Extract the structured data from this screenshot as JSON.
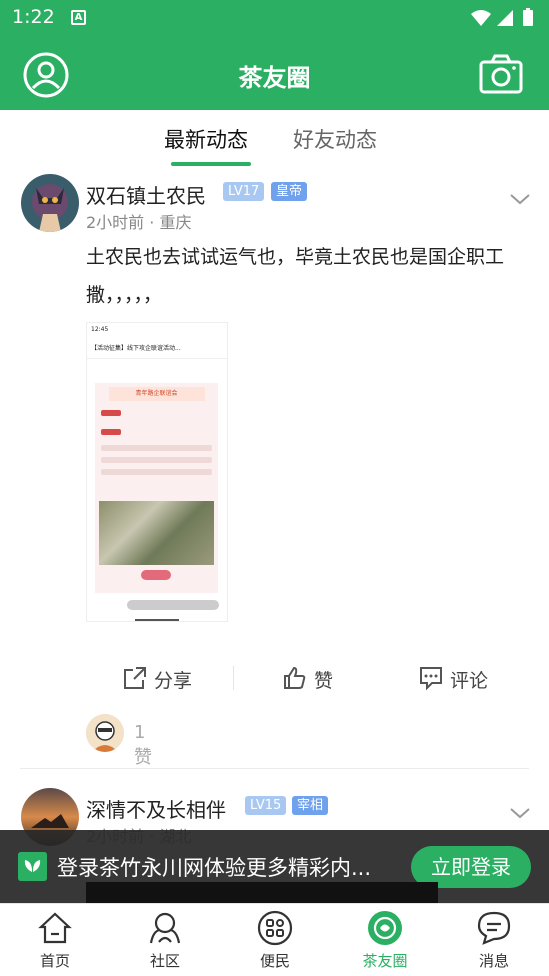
{
  "status_bar": {
    "time": "1:22",
    "notification_icon": "A"
  },
  "header": {
    "title": "茶友圈"
  },
  "tabs": [
    {
      "label": "最新动态",
      "active": true
    },
    {
      "label": "好友动态",
      "active": false
    }
  ],
  "posts": [
    {
      "author": "双石镇土农民",
      "level": "LV17",
      "rank": "皇帝",
      "meta": "2小时前 · 重庆",
      "text": "土农民也去试试运气也，毕竟土农民也是国企职工撒，，，，，",
      "image": {
        "time": "12:45",
        "title": "【活动征集】线下攻企联谊活动...",
        "card_title": "青年路企联谊会"
      },
      "actions": {
        "share": "分享",
        "like": "赞",
        "comment": "评论"
      },
      "likes_count": "1赞"
    },
    {
      "author": "深情不及长相伴",
      "level": "LV15",
      "rank": "宰相",
      "meta": "2小时前 · 湖北"
    }
  ],
  "login_banner": {
    "text": "登录茶竹永川网体验更多精彩内...",
    "button": "立即登录"
  },
  "bottom_nav": [
    {
      "label": "首页",
      "icon": "home-icon",
      "active": false
    },
    {
      "label": "社区",
      "icon": "community-icon",
      "active": false
    },
    {
      "label": "便民",
      "icon": "services-icon",
      "active": false
    },
    {
      "label": "茶友圈",
      "icon": "tea-circle-icon",
      "active": true
    },
    {
      "label": "消息",
      "icon": "message-icon",
      "active": false
    }
  ],
  "colors": {
    "brand": "#2bb063",
    "level_badge": "#a8c8f2",
    "rank_badge": "#6fa1ec"
  }
}
